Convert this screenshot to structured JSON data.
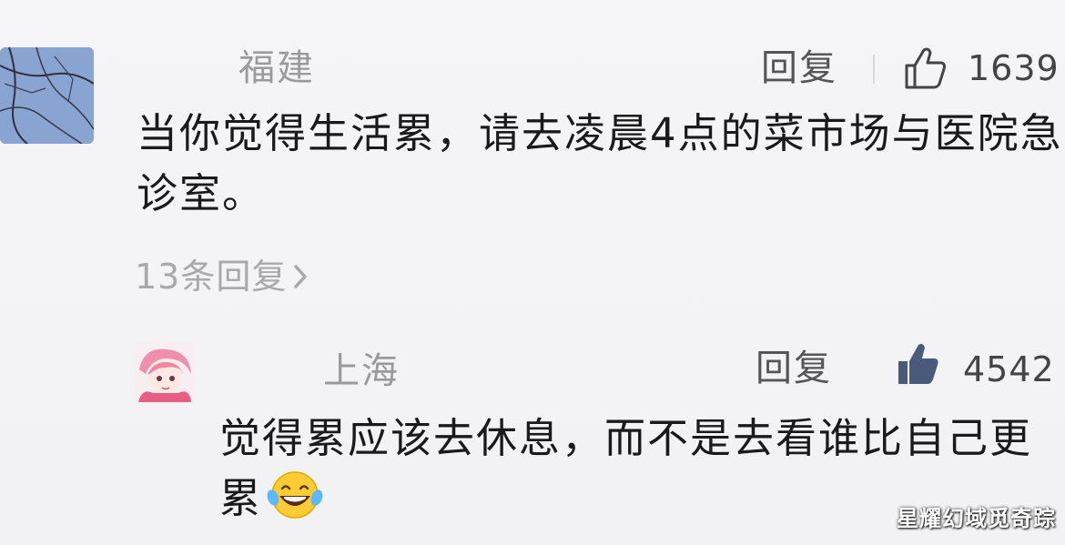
{
  "comments": [
    {
      "location": "福建",
      "reply_label": "回复",
      "likes": "1639",
      "text": "当你觉得生活累，请去凌晨4点的菜市场与医院急诊室。",
      "replies_link": "13条回复",
      "thumb_icon": "thumb-up-outline-icon"
    },
    {
      "location": "上海",
      "reply_label": "回复",
      "likes": "4542",
      "text": "觉得累应该去休息，而不是去看谁比自己更累",
      "thumb_icon": "thumb-up-filled-icon",
      "emoji": "laugh-cry-emoji"
    }
  ],
  "watermark": "星耀幻域觅奇踪",
  "colors": {
    "location": "#9a9a9a",
    "body_text": "#1a1a1a",
    "thumb_fill": "#4a5a7a"
  }
}
